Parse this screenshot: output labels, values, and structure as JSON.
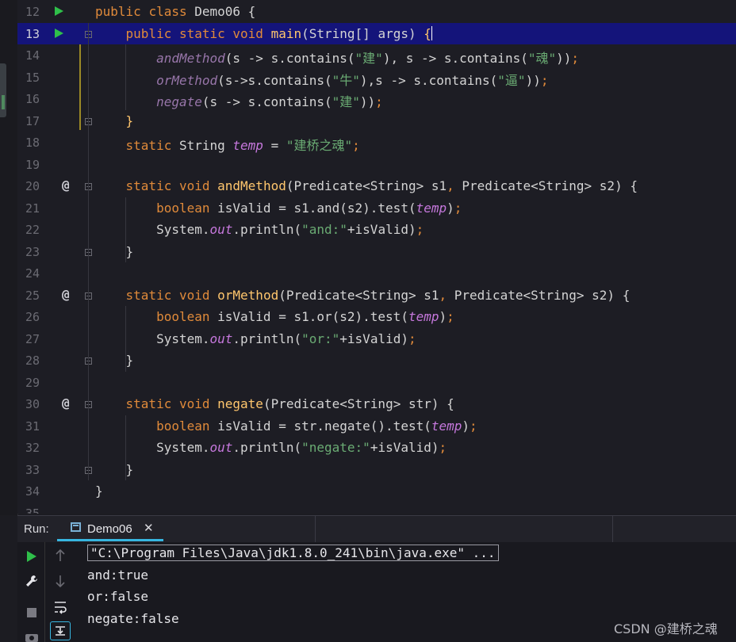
{
  "editor": {
    "lines": [
      {
        "n": "12",
        "run": true,
        "tokens": [
          {
            "t": "public ",
            "c": "k"
          },
          {
            "t": "class ",
            "c": "k"
          },
          {
            "t": "Demo06 {",
            "c": ""
          }
        ]
      },
      {
        "n": "13",
        "run": true,
        "current": true,
        "tokens": [
          {
            "t": "    "
          },
          {
            "t": "public ",
            "c": "k"
          },
          {
            "t": "static ",
            "c": "k"
          },
          {
            "t": "void ",
            "c": "k"
          },
          {
            "t": "main",
            "c": "f"
          },
          {
            "t": "(String[] args) "
          },
          {
            "t": "{",
            "c": "f"
          }
        ]
      },
      {
        "n": "14",
        "tokens": [
          {
            "t": "        "
          },
          {
            "t": "andMethod",
            "c": "it"
          },
          {
            "t": "(s -> s.contains("
          },
          {
            "t": "\"建\"",
            "c": "s"
          },
          {
            "t": "), s -> s.contains("
          },
          {
            "t": "\"魂\"",
            "c": "s"
          },
          {
            "t": "))"
          },
          {
            "t": ";",
            "c": "k"
          }
        ]
      },
      {
        "n": "15",
        "tokens": [
          {
            "t": "        "
          },
          {
            "t": "orMethod",
            "c": "it"
          },
          {
            "t": "(s->s.contains("
          },
          {
            "t": "\"牛\"",
            "c": "s"
          },
          {
            "t": "),s -> s.contains("
          },
          {
            "t": "\"逼\"",
            "c": "s"
          },
          {
            "t": "))"
          },
          {
            "t": ";",
            "c": "k"
          }
        ]
      },
      {
        "n": "16",
        "tokens": [
          {
            "t": "        "
          },
          {
            "t": "negate",
            "c": "it"
          },
          {
            "t": "(s -> s.contains("
          },
          {
            "t": "\"建\"",
            "c": "s"
          },
          {
            "t": "))"
          },
          {
            "t": ";",
            "c": "k"
          }
        ]
      },
      {
        "n": "17",
        "tokens": [
          {
            "t": "    "
          },
          {
            "t": "}",
            "c": "f"
          }
        ]
      },
      {
        "n": "18",
        "tokens": [
          {
            "t": "    "
          },
          {
            "t": "static ",
            "c": "k"
          },
          {
            "t": "String "
          },
          {
            "t": "temp",
            "c": "pl"
          },
          {
            "t": " = "
          },
          {
            "t": "\"建桥之魂\"",
            "c": "s"
          },
          {
            "t": ";",
            "c": "k"
          }
        ]
      },
      {
        "n": "19",
        "tokens": []
      },
      {
        "n": "20",
        "at": true,
        "tokens": [
          {
            "t": "    "
          },
          {
            "t": "static ",
            "c": "k"
          },
          {
            "t": "void ",
            "c": "k"
          },
          {
            "t": "andMethod",
            "c": "f"
          },
          {
            "t": "(Predicate<String> s1"
          },
          {
            "t": ", ",
            "c": "k"
          },
          {
            "t": "Predicate<String> s2) {"
          }
        ]
      },
      {
        "n": "21",
        "tokens": [
          {
            "t": "        "
          },
          {
            "t": "boolean ",
            "c": "k"
          },
          {
            "t": "isValid = s1.and(s2).test("
          },
          {
            "t": "temp",
            "c": "pl"
          },
          {
            "t": ")"
          },
          {
            "t": ";",
            "c": "k"
          }
        ]
      },
      {
        "n": "22",
        "tokens": [
          {
            "t": "        "
          },
          {
            "t": "System."
          },
          {
            "t": "out",
            "c": "pl"
          },
          {
            "t": ".println("
          },
          {
            "t": "\"and:\"",
            "c": "s"
          },
          {
            "t": "+isValid)"
          },
          {
            "t": ";",
            "c": "k"
          }
        ]
      },
      {
        "n": "23",
        "tokens": [
          {
            "t": "    }"
          }
        ]
      },
      {
        "n": "24",
        "tokens": []
      },
      {
        "n": "25",
        "at": true,
        "tokens": [
          {
            "t": "    "
          },
          {
            "t": "static ",
            "c": "k"
          },
          {
            "t": "void ",
            "c": "k"
          },
          {
            "t": "orMethod",
            "c": "f"
          },
          {
            "t": "(Predicate<String> s1"
          },
          {
            "t": ", ",
            "c": "k"
          },
          {
            "t": "Predicate<String> s2) {"
          }
        ]
      },
      {
        "n": "26",
        "tokens": [
          {
            "t": "        "
          },
          {
            "t": "boolean ",
            "c": "k"
          },
          {
            "t": "isValid = s1.or(s2).test("
          },
          {
            "t": "temp",
            "c": "pl"
          },
          {
            "t": ")"
          },
          {
            "t": ";",
            "c": "k"
          }
        ]
      },
      {
        "n": "27",
        "tokens": [
          {
            "t": "        "
          },
          {
            "t": "System."
          },
          {
            "t": "out",
            "c": "pl"
          },
          {
            "t": ".println("
          },
          {
            "t": "\"or:\"",
            "c": "s"
          },
          {
            "t": "+isValid)"
          },
          {
            "t": ";",
            "c": "k"
          }
        ]
      },
      {
        "n": "28",
        "tokens": [
          {
            "t": "    }"
          }
        ]
      },
      {
        "n": "29",
        "tokens": []
      },
      {
        "n": "30",
        "at": true,
        "tokens": [
          {
            "t": "    "
          },
          {
            "t": "static ",
            "c": "k"
          },
          {
            "t": "void ",
            "c": "k"
          },
          {
            "t": "negate",
            "c": "f"
          },
          {
            "t": "(Predicate<String> str) {"
          }
        ]
      },
      {
        "n": "31",
        "tokens": [
          {
            "t": "        "
          },
          {
            "t": "boolean ",
            "c": "k"
          },
          {
            "t": "isValid = str.negate().test("
          },
          {
            "t": "temp",
            "c": "pl"
          },
          {
            "t": ")"
          },
          {
            "t": ";",
            "c": "k"
          }
        ]
      },
      {
        "n": "32",
        "tokens": [
          {
            "t": "        "
          },
          {
            "t": "System."
          },
          {
            "t": "out",
            "c": "pl"
          },
          {
            "t": ".println("
          },
          {
            "t": "\"negate:\"",
            "c": "s"
          },
          {
            "t": "+isValid)"
          },
          {
            "t": ";",
            "c": "k"
          }
        ]
      },
      {
        "n": "33",
        "tokens": [
          {
            "t": "    }"
          }
        ]
      },
      {
        "n": "34",
        "tokens": [
          {
            "t": "}"
          }
        ]
      },
      {
        "n": "35",
        "tokens": []
      }
    ]
  },
  "run_panel": {
    "label": "Run:",
    "tab_name": "Demo06",
    "tab_close": "✕"
  },
  "console": {
    "command": "\"C:\\Program Files\\Java\\jdk1.8.0_241\\bin\\java.exe\" ...",
    "lines": [
      "and:true",
      "or:false",
      "negate:false"
    ]
  },
  "watermark": "CSDN @建桥之魂",
  "colors": {
    "keyword": "#e08a3a",
    "string": "#6aab73",
    "function": "#ffc66d",
    "field": "#c678dd",
    "current_line": "#14147a",
    "run_green": "#2fbf4a",
    "tab_underline": "#37b6e0"
  }
}
